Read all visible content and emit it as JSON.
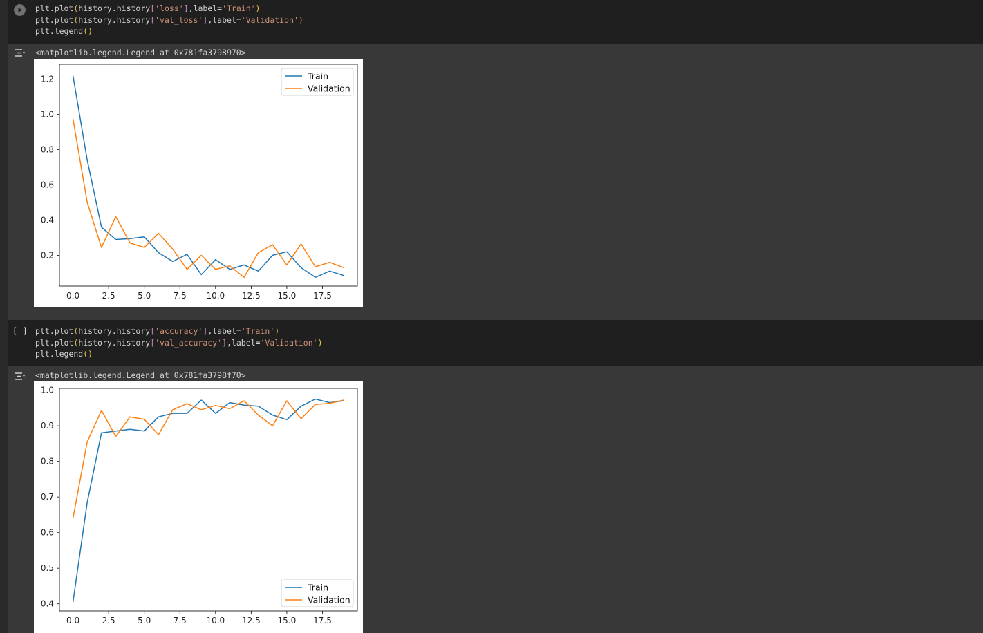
{
  "cells": [
    {
      "code": {
        "lines": [
          [
            {
              "t": "plt.plot",
              "c": "fn"
            },
            {
              "t": "(",
              "c": "paren"
            },
            {
              "t": "history.history",
              "c": "fn"
            },
            {
              "t": "[",
              "c": "inner"
            },
            {
              "t": "'loss'",
              "c": "str"
            },
            {
              "t": "]",
              "c": "inner"
            },
            {
              "t": ",label=",
              "c": "fn"
            },
            {
              "t": "'Train'",
              "c": "str"
            },
            {
              "t": ")",
              "c": "paren"
            }
          ],
          [
            {
              "t": "plt.plot",
              "c": "fn"
            },
            {
              "t": "(",
              "c": "paren"
            },
            {
              "t": "history.history",
              "c": "fn"
            },
            {
              "t": "[",
              "c": "inner"
            },
            {
              "t": "'val_loss'",
              "c": "str"
            },
            {
              "t": "]",
              "c": "inner"
            },
            {
              "t": ",label=",
              "c": "fn"
            },
            {
              "t": "'Validation'",
              "c": "str"
            },
            {
              "t": ")",
              "c": "paren"
            }
          ],
          [
            {
              "t": "plt.legend",
              "c": "fn"
            },
            {
              "t": "()",
              "c": "paren"
            }
          ]
        ]
      },
      "output_text": "<matplotlib.legend.Legend at 0x781fa3798970>"
    },
    {
      "bracket": "[ ]",
      "code": {
        "lines": [
          [
            {
              "t": "plt.plot",
              "c": "fn"
            },
            {
              "t": "(",
              "c": "paren"
            },
            {
              "t": "history.history",
              "c": "fn"
            },
            {
              "t": "[",
              "c": "inner"
            },
            {
              "t": "'accuracy'",
              "c": "str"
            },
            {
              "t": "]",
              "c": "inner"
            },
            {
              "t": ",label=",
              "c": "fn"
            },
            {
              "t": "'Train'",
              "c": "str"
            },
            {
              "t": ")",
              "c": "paren"
            }
          ],
          [
            {
              "t": "plt.plot",
              "c": "fn"
            },
            {
              "t": "(",
              "c": "paren"
            },
            {
              "t": "history.history",
              "c": "fn"
            },
            {
              "t": "[",
              "c": "inner"
            },
            {
              "t": "'val_accuracy'",
              "c": "str"
            },
            {
              "t": "]",
              "c": "inner"
            },
            {
              "t": ",label=",
              "c": "fn"
            },
            {
              "t": "'Validation'",
              "c": "str"
            },
            {
              "t": ")",
              "c": "paren"
            }
          ],
          [
            {
              "t": "plt.legend",
              "c": "fn"
            },
            {
              "t": "()",
              "c": "paren"
            }
          ]
        ]
      },
      "output_text": "<matplotlib.legend.Legend at 0x781fa3798f70>"
    }
  ],
  "colors": {
    "train": "#1f77b4",
    "validation": "#ff7f0e",
    "cell_bg": "#1f1f1f",
    "output_bg": "#383838"
  },
  "chart_data": [
    {
      "type": "line",
      "title": "",
      "xlabel": "",
      "ylabel": "",
      "x": [
        0,
        1,
        2,
        3,
        4,
        5,
        6,
        7,
        8,
        9,
        10,
        11,
        12,
        13,
        14,
        15,
        16,
        17,
        18,
        19
      ],
      "xticks": [
        "0.0",
        "2.5",
        "5.0",
        "7.5",
        "10.0",
        "12.5",
        "15.0",
        "17.5"
      ],
      "xtick_values": [
        0,
        2.5,
        5,
        7.5,
        10,
        12.5,
        15,
        17.5
      ],
      "yticks": [
        "0.2",
        "0.4",
        "0.6",
        "0.8",
        "1.0",
        "1.2"
      ],
      "ytick_values": [
        0.2,
        0.4,
        0.6,
        0.8,
        1.0,
        1.2
      ],
      "xlim": [
        -0.95,
        19.95
      ],
      "ylim": [
        0.025,
        1.285
      ],
      "legend_position": "upper right",
      "grid": false,
      "series": [
        {
          "name": "Train",
          "color": "#1f77b4",
          "values": [
            1.22,
            0.74,
            0.36,
            0.29,
            0.295,
            0.305,
            0.215,
            0.165,
            0.205,
            0.09,
            0.175,
            0.12,
            0.145,
            0.11,
            0.2,
            0.22,
            0.13,
            0.075,
            0.11,
            0.085
          ]
        },
        {
          "name": "Validation",
          "color": "#ff7f0e",
          "values": [
            0.975,
            0.5,
            0.245,
            0.42,
            0.27,
            0.245,
            0.325,
            0.235,
            0.12,
            0.2,
            0.12,
            0.14,
            0.075,
            0.215,
            0.26,
            0.145,
            0.265,
            0.135,
            0.16,
            0.13
          ]
        }
      ]
    },
    {
      "type": "line",
      "title": "",
      "xlabel": "",
      "ylabel": "",
      "x": [
        0,
        1,
        2,
        3,
        4,
        5,
        6,
        7,
        8,
        9,
        10,
        11,
        12,
        13,
        14,
        15,
        16,
        17,
        18,
        19
      ],
      "xticks": [
        "0.0",
        "2.5",
        "5.0",
        "7.5",
        "10.0",
        "12.5",
        "15.0",
        "17.5"
      ],
      "xtick_values": [
        0,
        2.5,
        5,
        7.5,
        10,
        12.5,
        15,
        17.5
      ],
      "yticks": [
        "0.4",
        "0.5",
        "0.6",
        "0.7",
        "0.8",
        "0.9",
        "1.0"
      ],
      "ytick_values": [
        0.4,
        0.5,
        0.6,
        0.7,
        0.8,
        0.9,
        1.0
      ],
      "xlim": [
        -0.95,
        19.95
      ],
      "ylim": [
        0.38,
        1.005
      ],
      "legend_position": "lower right",
      "grid": false,
      "series": [
        {
          "name": "Train",
          "color": "#1f77b4",
          "values": [
            0.405,
            0.685,
            0.88,
            0.885,
            0.89,
            0.885,
            0.925,
            0.935,
            0.935,
            0.972,
            0.935,
            0.965,
            0.958,
            0.955,
            0.93,
            0.917,
            0.955,
            0.975,
            0.965,
            0.97
          ]
        },
        {
          "name": "Validation",
          "color": "#ff7f0e",
          "values": [
            0.64,
            0.855,
            0.943,
            0.87,
            0.925,
            0.918,
            0.875,
            0.945,
            0.962,
            0.945,
            0.957,
            0.948,
            0.97,
            0.93,
            0.9,
            0.97,
            0.92,
            0.96,
            0.963,
            0.972
          ]
        }
      ]
    }
  ]
}
